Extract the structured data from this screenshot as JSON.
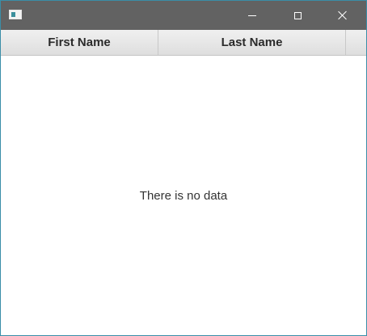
{
  "window": {
    "icon": "app-window-icon",
    "controls": {
      "minimize_icon": "minimize-icon",
      "maximize_icon": "maximize-icon",
      "close_icon": "close-icon"
    }
  },
  "table": {
    "columns": [
      {
        "label": "First Name"
      },
      {
        "label": "Last Name"
      }
    ],
    "rows": [],
    "placeholder": "There is no data"
  },
  "colors": {
    "titlebar": "#626262",
    "window_border": "#3a8ea8",
    "header_background": "#e6e6e6"
  }
}
